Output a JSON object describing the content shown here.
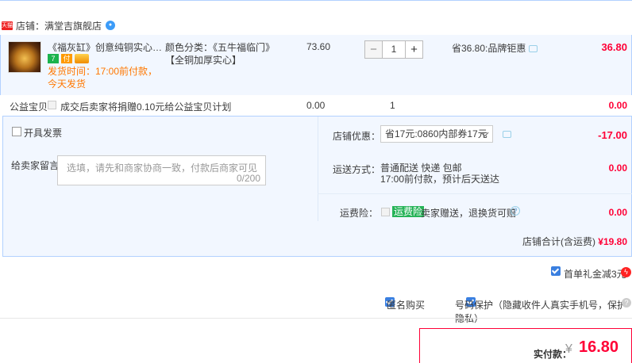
{
  "shop": {
    "label": "店铺：",
    "name": "满堂吉旗舰店",
    "tmall_badge": "天猫"
  },
  "item": {
    "title": "《福灰缸》创意纯铜实心烟缸客厅中式…",
    "delivery": "发货时间：17:00前付款，今天发货",
    "sku": "颜色分类：《五牛福临门》【全铜加厚实心】",
    "price": "73.60",
    "quantity": "1",
    "minus": "−",
    "plus": "+",
    "savings": "省36.80:品牌钜惠",
    "total": "36.80",
    "badge_seven": "7",
    "badge_pay": "付"
  },
  "charity": {
    "label": "公益宝贝",
    "text": "成交后卖家将捐赠0.10元给公益宝贝计划",
    "price": "0.00",
    "qty": "1",
    "total": "0.00"
  },
  "invoice": {
    "label": "开具发票"
  },
  "message": {
    "label": "给卖家留言：",
    "placeholder": "选填，请先和商家协商一致，付款后商家可见",
    "count": "0/200"
  },
  "discount": {
    "label": "店铺优惠：",
    "selected": "省17元:0860内部券17元",
    "value": "-17.00"
  },
  "delivery": {
    "label": "运送方式：",
    "method": "普通配送 快递 包邮",
    "eta": "17:00前付款，预计后天送达",
    "value": "0.00"
  },
  "insurance": {
    "label": "运费险：",
    "tag": "运费险",
    "text": "卖家赠送，退换货可赔",
    "value": "0.00"
  },
  "summary": {
    "label": "店铺合计(含运费)",
    "value": "¥19.80"
  },
  "gift": {
    "label": "首单礼金减3元",
    "icon": "ϟ"
  },
  "anonymous": {
    "label": "匿名购买"
  },
  "privacy": {
    "label": "号码保护（隐藏收件人真实手机号，保护隐私）"
  },
  "pay": {
    "label": "实付款：",
    "currency": "¥",
    "amount": "16.80"
  },
  "colors": {
    "accent": "#ff0036",
    "blue_border": "#b2d1ff",
    "panel": "#f2f7ff",
    "orange": "#ff7700"
  }
}
